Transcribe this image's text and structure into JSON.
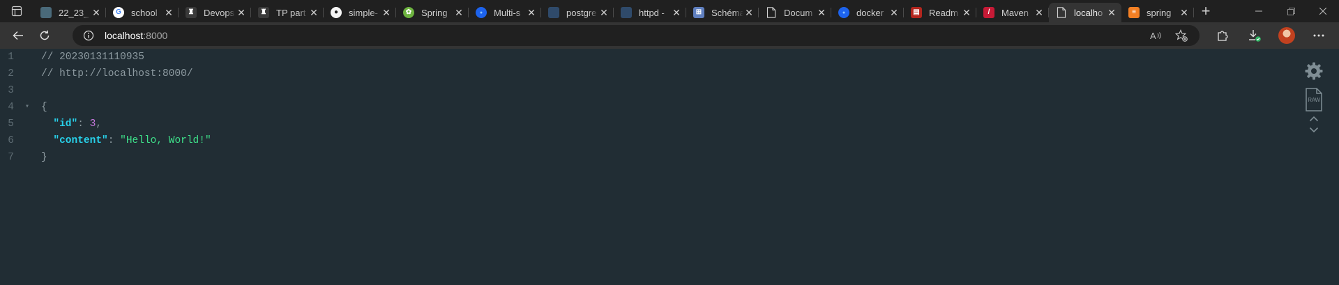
{
  "tabs": [
    {
      "title": "22_23_",
      "favicon": "doc-thumbnail-icon",
      "color": "#4a6a7a",
      "glyph": ""
    },
    {
      "title": "school",
      "favicon": "google-icon",
      "color": "#ffffff",
      "glyph": "G"
    },
    {
      "title": "Devops",
      "favicon": "hat-icon",
      "color": "#3a3a3a",
      "glyph": "♜"
    },
    {
      "title": "TP part",
      "favicon": "hat-icon",
      "color": "#3a3a3a",
      "glyph": "♜"
    },
    {
      "title": "simple-",
      "favicon": "github-icon",
      "color": "#f5f5f5",
      "glyph": "●"
    },
    {
      "title": "Spring",
      "favicon": "spring-icon",
      "color": "#6db33f",
      "glyph": "✿"
    },
    {
      "title": "Multi-s",
      "favicon": "docker-icon",
      "color": "#1d63ed",
      "glyph": "●"
    },
    {
      "title": "postgre",
      "favicon": "postgres-icon",
      "color": "#2f4a6a",
      "glyph": ""
    },
    {
      "title": "httpd -",
      "favicon": "apache-icon",
      "color": "#2f4a6a",
      "glyph": ""
    },
    {
      "title": "Schéma",
      "favicon": "diagram-icon",
      "color": "#5f7fbf",
      "glyph": "⊞"
    },
    {
      "title": "Docum",
      "favicon": "document-icon",
      "color": "transparent",
      "glyph": ""
    },
    {
      "title": "docker",
      "favicon": "docker-icon",
      "color": "#1d63ed",
      "glyph": "●"
    },
    {
      "title": "Readm",
      "favicon": "readme-icon",
      "color": "#b3261e",
      "glyph": "▤"
    },
    {
      "title": "Maven",
      "favicon": "maven-feather-icon",
      "color": "#c71a36",
      "glyph": "/"
    },
    {
      "title": "localho",
      "favicon": "document-icon",
      "color": "transparent",
      "glyph": "",
      "active": true
    },
    {
      "title": "spring",
      "favicon": "stackoverflow-icon",
      "color": "#f48024",
      "glyph": "≡"
    }
  ],
  "address": {
    "host": "localhost",
    "port": ":8000"
  },
  "json_view": {
    "lines": [
      {
        "n": "1",
        "fold": "",
        "tokens": [
          {
            "t": "// 20230131110935",
            "c": "comment"
          }
        ]
      },
      {
        "n": "2",
        "fold": "",
        "tokens": [
          {
            "t": "// http://localhost:8000/",
            "c": "comment"
          }
        ]
      },
      {
        "n": "3",
        "fold": "",
        "tokens": []
      },
      {
        "n": "4",
        "fold": "▾",
        "tokens": [
          {
            "t": "{",
            "c": "punct"
          }
        ]
      },
      {
        "n": "5",
        "fold": "",
        "tokens": [
          {
            "t": "  ",
            "c": "punct"
          },
          {
            "t": "\"id\"",
            "c": "key"
          },
          {
            "t": ": ",
            "c": "punct"
          },
          {
            "t": "3",
            "c": "num"
          },
          {
            "t": ",",
            "c": "punct"
          }
        ]
      },
      {
        "n": "6",
        "fold": "",
        "tokens": [
          {
            "t": "  ",
            "c": "punct"
          },
          {
            "t": "\"content\"",
            "c": "key"
          },
          {
            "t": ": ",
            "c": "punct"
          },
          {
            "t": "\"Hello, World!\"",
            "c": "str"
          }
        ]
      },
      {
        "n": "7",
        "fold": "",
        "tokens": [
          {
            "t": "}",
            "c": "punct"
          }
        ]
      }
    ]
  },
  "raw_button": {
    "label": "RAW"
  }
}
